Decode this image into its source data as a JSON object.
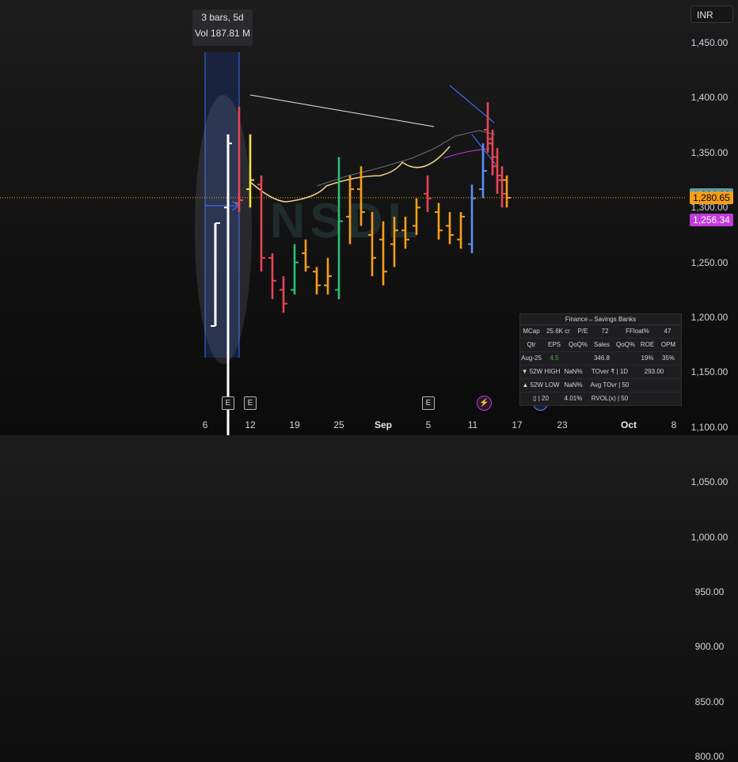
{
  "currency": "INR",
  "tooltip": {
    "line1": "3 bars, 5d",
    "line2": "Vol 187.81 M"
  },
  "price_axis": [
    "1,450.00",
    "1,400.00",
    "1,350.00",
    "1,300.00",
    "1,250.00",
    "1,200.00",
    "1,150.00",
    "1,100.00",
    "1,050.00",
    "1,000.00",
    "950.00",
    "900.00",
    "850.00",
    "800.00"
  ],
  "price_tags": [
    {
      "value": "1,284.00",
      "price": 1284,
      "color": "#5b9fb3"
    },
    {
      "value": "1,280.65",
      "price": 1280.65,
      "color": "#f59e1b"
    },
    {
      "value": "1,256.34",
      "price": 1256.34,
      "color": "#c13bd9"
    }
  ],
  "date_axis": [
    {
      "label": "6",
      "bold": false
    },
    {
      "label": "12",
      "bold": false
    },
    {
      "label": "19",
      "bold": false
    },
    {
      "label": "25",
      "bold": false
    },
    {
      "label": "Sep",
      "bold": true
    },
    {
      "label": "5",
      "bold": false
    },
    {
      "label": "11",
      "bold": false
    },
    {
      "label": "17",
      "bold": false
    },
    {
      "label": "23",
      "bold": false
    },
    {
      "label": "Oct",
      "bold": true
    },
    {
      "label": "8",
      "bold": false
    }
  ],
  "events": {
    "earnings1": "E",
    "earnings2": "E",
    "earnings3": "E",
    "split": "⚡",
    "dividend": "D"
  },
  "watermark": "NSDL",
  "colors": {
    "current_price_line": "#f59e1b",
    "up": "#2fbf71",
    "down": "#e84555",
    "neutral": "#ffffff",
    "amber": "#f59e1b",
    "blue": "#5b8ef5",
    "yellow": "#f5e04a"
  },
  "info_table": {
    "title": "Finance↔Savings Banks",
    "rows": [
      [
        "MCap",
        "25.6K cr",
        "P/E",
        "72",
        "FFloat%",
        "47"
      ],
      [
        "Qtr",
        "EPS",
        "QoQ%",
        "Sales",
        "QoQ%",
        "ROE",
        "OPM"
      ],
      [
        "Aug-25",
        "4.5",
        "",
        "346.8",
        "",
        "19%",
        "35%"
      ],
      [
        "▼ 52W HIGH",
        "NaN%",
        "TOver ₹ | 1D",
        "293.00"
      ],
      [
        "▲ 52W LOW",
        "NaN%",
        "Avg TOvr | 50"
      ],
      [
        "▯ | 20",
        "4.01%",
        "RVOL(x) | 50"
      ]
    ]
  },
  "chart_data": {
    "type": "ohlc",
    "interval": "1D",
    "current_price": 1280.65,
    "ylim": [
      790,
      1480
    ],
    "bars": [
      {
        "date": "Aug 11",
        "open": 1270,
        "high": 1350,
        "low": 920,
        "close": 1340,
        "color": "neutral"
      },
      {
        "date": "Aug 12",
        "open": 1275,
        "high": 1380,
        "low": 1265,
        "close": 1278,
        "color": "down"
      },
      {
        "date": "Aug 13",
        "open": 1290,
        "high": 1350,
        "low": 1270,
        "close": 1300,
        "color": "yellow"
      },
      {
        "date": "Aug 14",
        "open": 1295,
        "high": 1305,
        "low": 1200,
        "close": 1215,
        "color": "down"
      },
      {
        "date": "Aug 18",
        "open": 1215,
        "high": 1220,
        "low": 1170,
        "close": 1190,
        "color": "down"
      },
      {
        "date": "Aug 19",
        "open": 1180,
        "high": 1195,
        "low": 1155,
        "close": 1165,
        "color": "down"
      },
      {
        "date": "Aug 20",
        "open": 1180,
        "high": 1230,
        "low": 1175,
        "close": 1210,
        "color": "up"
      },
      {
        "date": "Aug 21",
        "open": 1220,
        "high": 1235,
        "low": 1200,
        "close": 1205,
        "color": "amber"
      },
      {
        "date": "Aug 22",
        "open": 1200,
        "high": 1205,
        "low": 1175,
        "close": 1185,
        "color": "amber"
      },
      {
        "date": "Aug 25",
        "open": 1185,
        "high": 1215,
        "low": 1175,
        "close": 1195,
        "color": "amber"
      },
      {
        "date": "Aug 26",
        "open": 1180,
        "high": 1325,
        "low": 1170,
        "close": 1255,
        "color": "up"
      },
      {
        "date": "Aug 27",
        "open": 1260,
        "high": 1305,
        "low": 1230,
        "close": 1290,
        "color": "amber"
      },
      {
        "date": "Aug 28",
        "open": 1290,
        "high": 1315,
        "low": 1250,
        "close": 1265,
        "color": "amber"
      },
      {
        "date": "Aug 29",
        "open": 1240,
        "high": 1265,
        "low": 1195,
        "close": 1215,
        "color": "amber"
      },
      {
        "date": "Sep 1",
        "open": 1235,
        "high": 1255,
        "low": 1185,
        "close": 1200,
        "color": "amber"
      },
      {
        "date": "Sep 2",
        "open": 1230,
        "high": 1260,
        "low": 1205,
        "close": 1245,
        "color": "amber"
      },
      {
        "date": "Sep 3",
        "open": 1245,
        "high": 1260,
        "low": 1225,
        "close": 1235,
        "color": "amber"
      },
      {
        "date": "Sep 4",
        "open": 1250,
        "high": 1280,
        "low": 1240,
        "close": 1270,
        "color": "amber"
      },
      {
        "date": "Sep 5",
        "open": 1285,
        "high": 1305,
        "low": 1265,
        "close": 1280,
        "color": "down"
      },
      {
        "date": "Sep 8",
        "open": 1265,
        "high": 1275,
        "low": 1235,
        "close": 1245,
        "color": "amber"
      },
      {
        "date": "Sep 9",
        "open": 1250,
        "high": 1265,
        "low": 1230,
        "close": 1240,
        "color": "amber"
      },
      {
        "date": "Sep 10",
        "open": 1235,
        "high": 1265,
        "low": 1225,
        "close": 1260,
        "color": "amber"
      },
      {
        "date": "Sep 11",
        "open": 1230,
        "high": 1295,
        "low": 1220,
        "close": 1280,
        "color": "blue"
      },
      {
        "date": "Sep 12",
        "open": 1290,
        "high": 1340,
        "low": 1280,
        "close": 1310,
        "color": "blue"
      },
      {
        "date": "Sep 15",
        "open": 1355,
        "high": 1385,
        "low": 1330,
        "close": 1345,
        "color": "down"
      },
      {
        "date": "Sep 16",
        "open": 1340,
        "high": 1355,
        "low": 1305,
        "close": 1315,
        "color": "down"
      },
      {
        "date": "Sep 17",
        "open": 1325,
        "high": 1335,
        "low": 1285,
        "close": 1300,
        "color": "down"
      },
      {
        "date": "Sep 18",
        "open": 1305,
        "high": 1315,
        "low": 1270,
        "close": 1285,
        "color": "down"
      },
      {
        "date": "Sep 19",
        "open": 1300,
        "high": 1305,
        "low": 1270,
        "close": 1280.65,
        "color": "amber"
      }
    ],
    "highlight_range": {
      "start": "Aug 11",
      "end": "Aug 13",
      "bars": 3
    }
  }
}
